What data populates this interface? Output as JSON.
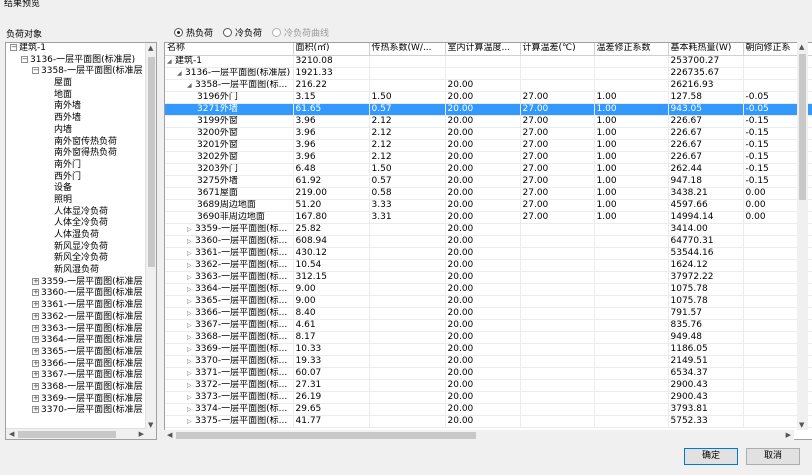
{
  "window": {
    "title": "结果预览"
  },
  "left": {
    "label": "负荷对象"
  },
  "radios": [
    {
      "label": "热负荷",
      "checked": true,
      "disabled": false
    },
    {
      "label": "冷负荷",
      "checked": false,
      "disabled": false
    },
    {
      "label": "冷负荷曲线",
      "checked": false,
      "disabled": true
    }
  ],
  "tree": [
    {
      "label": "建筑-1",
      "exp": "−"
    },
    {
      "label": "3136-一层平面图(标准层)",
      "exp": "−"
    },
    {
      "label": "3358-一层平面图(标准层",
      "exp": "−"
    },
    {
      "label": "屋面",
      "exp": ""
    },
    {
      "label": "地面",
      "exp": ""
    },
    {
      "label": "南外墙",
      "exp": ""
    },
    {
      "label": "西外墙",
      "exp": ""
    },
    {
      "label": "内墙",
      "exp": ""
    },
    {
      "label": "南外窗传热负荷",
      "exp": ""
    },
    {
      "label": "南外窗得热负荷",
      "exp": ""
    },
    {
      "label": "南外门",
      "exp": ""
    },
    {
      "label": "西外门",
      "exp": ""
    },
    {
      "label": "设备",
      "exp": ""
    },
    {
      "label": "照明",
      "exp": ""
    },
    {
      "label": "人体显冷负荷",
      "exp": ""
    },
    {
      "label": "人体全冷负荷",
      "exp": ""
    },
    {
      "label": "人体湿负荷",
      "exp": ""
    },
    {
      "label": "新风显冷负荷",
      "exp": ""
    },
    {
      "label": "新风全冷负荷",
      "exp": ""
    },
    {
      "label": "新风湿负荷",
      "exp": ""
    },
    {
      "label": "3359-一层平面图(标准层",
      "exp": "+"
    },
    {
      "label": "3360-一层平面图(标准层",
      "exp": "+"
    },
    {
      "label": "3361-一层平面图(标准层",
      "exp": "+"
    },
    {
      "label": "3362-一层平面图(标准层",
      "exp": "+"
    },
    {
      "label": "3363-一层平面图(标准层",
      "exp": "+"
    },
    {
      "label": "3364-一层平面图(标准层",
      "exp": "+"
    },
    {
      "label": "3365-一层平面图(标准层",
      "exp": "+"
    },
    {
      "label": "3366-一层平面图(标准层",
      "exp": "+"
    },
    {
      "label": "3367-一层平面图(标准层",
      "exp": "+"
    },
    {
      "label": "3368-一层平面图(标准层",
      "exp": "+"
    },
    {
      "label": "3369-一层平面图(标准层",
      "exp": "+"
    },
    {
      "label": "3370-一层平面图(标准层",
      "exp": "+"
    }
  ],
  "columns": [
    "名称",
    "面积(㎡)",
    "传热系数(W/...",
    "室内计算温度...",
    "计算温差(℃)",
    "温差修正系数",
    "基本耗热量(W)",
    "朝向修正系"
  ],
  "rows": [
    {
      "level": 0,
      "tri": "◢",
      "cells": [
        "建筑-1",
        "3210.08",
        "",
        "",
        "",
        "",
        "253700.27",
        ""
      ]
    },
    {
      "level": 1,
      "tri": "◢",
      "cells": [
        "3136-一层平面图(标准层)",
        "1921.33",
        "",
        "",
        "",
        "",
        "226735.67",
        ""
      ]
    },
    {
      "level": 2,
      "tri": "◢",
      "cells": [
        "3358-一层平面图(标...",
        "216.22",
        "",
        "20.00",
        "",
        "",
        "26216.93",
        ""
      ]
    },
    {
      "level": 3,
      "tri": "",
      "cells": [
        "3196外门",
        "3.15",
        "1.50",
        "20.00",
        "27.00",
        "1.00",
        "127.58",
        "-0.05"
      ]
    },
    {
      "level": 3,
      "tri": "",
      "selected": true,
      "cells": [
        "3271外墙",
        "61.65",
        "0.57",
        "20.00",
        "27.00",
        "1.00",
        "943.05",
        "-0.05"
      ]
    },
    {
      "level": 3,
      "tri": "",
      "cells": [
        "3199外窗",
        "3.96",
        "2.12",
        "20.00",
        "27.00",
        "1.00",
        "226.67",
        "-0.15"
      ]
    },
    {
      "level": 3,
      "tri": "",
      "cells": [
        "3200外窗",
        "3.96",
        "2.12",
        "20.00",
        "27.00",
        "1.00",
        "226.67",
        "-0.15"
      ]
    },
    {
      "level": 3,
      "tri": "",
      "cells": [
        "3201外窗",
        "3.96",
        "2.12",
        "20.00",
        "27.00",
        "1.00",
        "226.67",
        "-0.15"
      ]
    },
    {
      "level": 3,
      "tri": "",
      "cells": [
        "3202外窗",
        "3.96",
        "2.12",
        "20.00",
        "27.00",
        "1.00",
        "226.67",
        "-0.15"
      ]
    },
    {
      "level": 3,
      "tri": "",
      "cells": [
        "3203外门",
        "6.48",
        "1.50",
        "20.00",
        "27.00",
        "1.00",
        "262.44",
        "-0.15"
      ]
    },
    {
      "level": 3,
      "tri": "",
      "cells": [
        "3275外墙",
        "61.92",
        "0.57",
        "20.00",
        "27.00",
        "1.00",
        "947.18",
        "-0.15"
      ]
    },
    {
      "level": 3,
      "tri": "",
      "cells": [
        "3671屋面",
        "219.00",
        "0.58",
        "20.00",
        "27.00",
        "1.00",
        "3438.21",
        "0.00"
      ]
    },
    {
      "level": 3,
      "tri": "",
      "cells": [
        "3689周边地面",
        "51.20",
        "3.33",
        "20.00",
        "27.00",
        "1.00",
        "4597.66",
        "0.00"
      ]
    },
    {
      "level": 3,
      "tri": "",
      "cells": [
        "3690非周边地面",
        "167.80",
        "3.31",
        "20.00",
        "27.00",
        "1.00",
        "14994.14",
        "0.00"
      ]
    },
    {
      "level": 2,
      "tri": "▷",
      "cells": [
        "3359-一层平面图(标...",
        "25.82",
        "",
        "20.00",
        "",
        "",
        "3414.00",
        ""
      ]
    },
    {
      "level": 2,
      "tri": "▷",
      "cells": [
        "3360-一层平面图(标...",
        "608.94",
        "",
        "20.00",
        "",
        "",
        "64770.31",
        ""
      ]
    },
    {
      "level": 2,
      "tri": "▷",
      "cells": [
        "3361-一层平面图(标...",
        "430.12",
        "",
        "20.00",
        "",
        "",
        "53544.16",
        ""
      ]
    },
    {
      "level": 2,
      "tri": "▷",
      "cells": [
        "3362-一层平面图(标...",
        "10.54",
        "",
        "20.00",
        "",
        "",
        "1624.12",
        ""
      ]
    },
    {
      "level": 2,
      "tri": "▷",
      "cells": [
        "3363-一层平面图(标...",
        "312.15",
        "",
        "20.00",
        "",
        "",
        "37972.22",
        ""
      ]
    },
    {
      "level": 2,
      "tri": "▷",
      "cells": [
        "3364-一层平面图(标...",
        "9.00",
        "",
        "20.00",
        "",
        "",
        "1075.78",
        ""
      ]
    },
    {
      "level": 2,
      "tri": "▷",
      "cells": [
        "3365-一层平面图(标...",
        "9.00",
        "",
        "20.00",
        "",
        "",
        "1075.78",
        ""
      ]
    },
    {
      "level": 2,
      "tri": "▷",
      "cells": [
        "3366-一层平面图(标...",
        "8.40",
        "",
        "20.00",
        "",
        "",
        "791.57",
        ""
      ]
    },
    {
      "level": 2,
      "tri": "▷",
      "cells": [
        "3367-一层平面图(标...",
        "4.61",
        "",
        "20.00",
        "",
        "",
        "835.76",
        ""
      ]
    },
    {
      "level": 2,
      "tri": "▷",
      "cells": [
        "3368-一层平面图(标...",
        "8.17",
        "",
        "20.00",
        "",
        "",
        "949.48",
        ""
      ]
    },
    {
      "level": 2,
      "tri": "▷",
      "cells": [
        "3369-一层平面图(标...",
        "10.33",
        "",
        "20.00",
        "",
        "",
        "1186.05",
        ""
      ]
    },
    {
      "level": 2,
      "tri": "▷",
      "cells": [
        "3370-一层平面图(标...",
        "19.33",
        "",
        "20.00",
        "",
        "",
        "2149.51",
        ""
      ]
    },
    {
      "level": 2,
      "tri": "▷",
      "cells": [
        "3371-一层平面图(标...",
        "60.07",
        "",
        "20.00",
        "",
        "",
        "6534.37",
        ""
      ]
    },
    {
      "level": 2,
      "tri": "▷",
      "cells": [
        "3372-一层平面图(标...",
        "27.31",
        "",
        "20.00",
        "",
        "",
        "2900.43",
        ""
      ]
    },
    {
      "level": 2,
      "tri": "▷",
      "cells": [
        "3373-一层平面图(标...",
        "26.19",
        "",
        "20.00",
        "",
        "",
        "2900.43",
        ""
      ]
    },
    {
      "level": 2,
      "tri": "▷",
      "cells": [
        "3374-一层平面图(标...",
        "29.65",
        "",
        "20.00",
        "",
        "",
        "3793.81",
        ""
      ]
    },
    {
      "level": 2,
      "tri": "▷",
      "cells": [
        "3375-一层平面图(标...",
        "41.77",
        "",
        "20.00",
        "",
        "",
        "5752.33",
        ""
      ]
    }
  ],
  "buttons": {
    "ok": "确定",
    "cancel": "取消"
  },
  "colors": {
    "selection": "#3399ff",
    "background": "#f0f0f0"
  }
}
